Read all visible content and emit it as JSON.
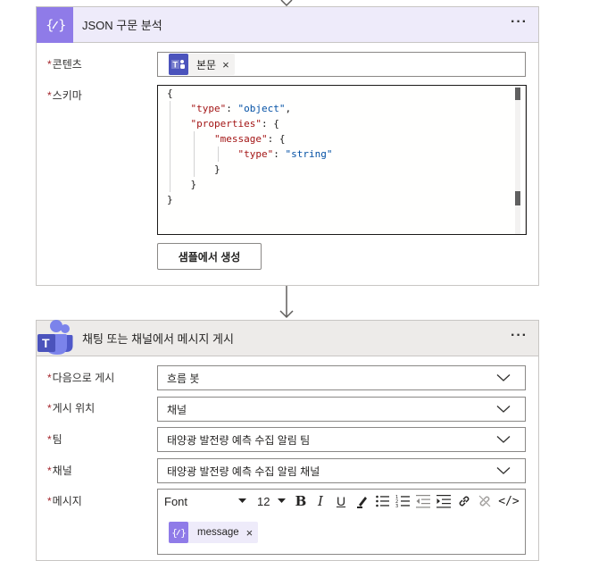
{
  "card1": {
    "title": "JSON 구문 분석",
    "more_label": "···",
    "content_label": "콘텐츠",
    "content_token": "본문",
    "schema_label": "스키마",
    "schema_lines": [
      "{",
      "    \"type\": \"object\",",
      "    \"properties\": {",
      "        \"message\": {",
      "            \"type\": \"string\"",
      "        }",
      "    }",
      "}"
    ],
    "generate_button": "샘플에서 생성"
  },
  "card2": {
    "title": "채팅 또는 채널에서 메시지 게시",
    "more_label": "···",
    "post_as_label": "다음으로 게시",
    "post_as_value": "흐름 봇",
    "post_in_label": "게시 위치",
    "post_in_value": "채널",
    "team_label": "팀",
    "team_value": "태양광 발전량 예측 수집 알림 팀",
    "channel_label": "채널",
    "channel_value": "태양광 발전량 예측 수집 알림 채널",
    "message_label": "메시지",
    "font_value": "Font",
    "font_size_value": "12",
    "bold_label": "B",
    "italic_label": "I",
    "underline_label": "U",
    "code_label": "</>",
    "message_token": "message"
  },
  "required_mark": "*",
  "close_mark": "×",
  "colors": {
    "json_header": "#eeebfa",
    "json_accent": "#8f7be8",
    "teams_accent": "#4b53bc",
    "required": "#a4262c"
  },
  "icons": [
    "json-curly-icon",
    "teams-icon",
    "chevron-down-icon",
    "close-icon",
    "down-arrow-icon",
    "more-icon"
  ]
}
